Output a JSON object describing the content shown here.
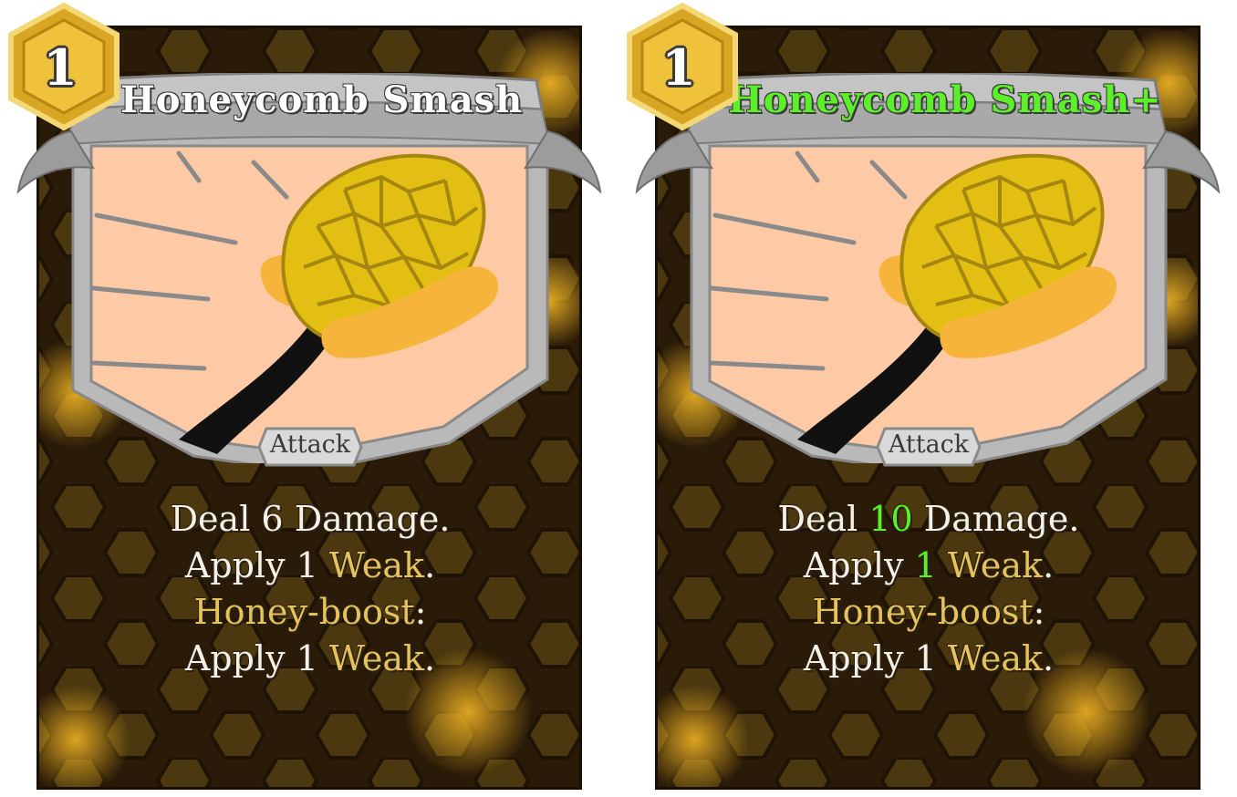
{
  "colors": {
    "keyword": "#e6c25a",
    "upgrade": "#5cf02a",
    "text": "#f5f1e6",
    "frame": "#b4b4b4",
    "honey": "#e3bf13"
  },
  "cards": [
    {
      "cost": "1",
      "title": "Honeycomb Smash",
      "type": "Attack",
      "lines": [
        {
          "a": "Deal ",
          "b": "6",
          "c": " Damage."
        },
        {
          "a": "Apply ",
          "b": "1",
          "c": " ",
          "d": "Weak",
          "e": "."
        },
        {
          "a": "Honey-boost",
          "b": ":"
        },
        {
          "a": "Apply 1 ",
          "b": "Weak",
          "c": "."
        }
      ]
    },
    {
      "cost": "1",
      "title": "Honeycomb Smash+",
      "type": "Attack",
      "lines": [
        {
          "a": "Deal ",
          "b": "10",
          "c": " Damage."
        },
        {
          "a": "Apply ",
          "b": "1",
          "c": " ",
          "d": "Weak",
          "e": "."
        },
        {
          "a": "Honey-boost",
          "b": ":"
        },
        {
          "a": "Apply 1 ",
          "b": "Weak",
          "c": "."
        }
      ]
    }
  ]
}
